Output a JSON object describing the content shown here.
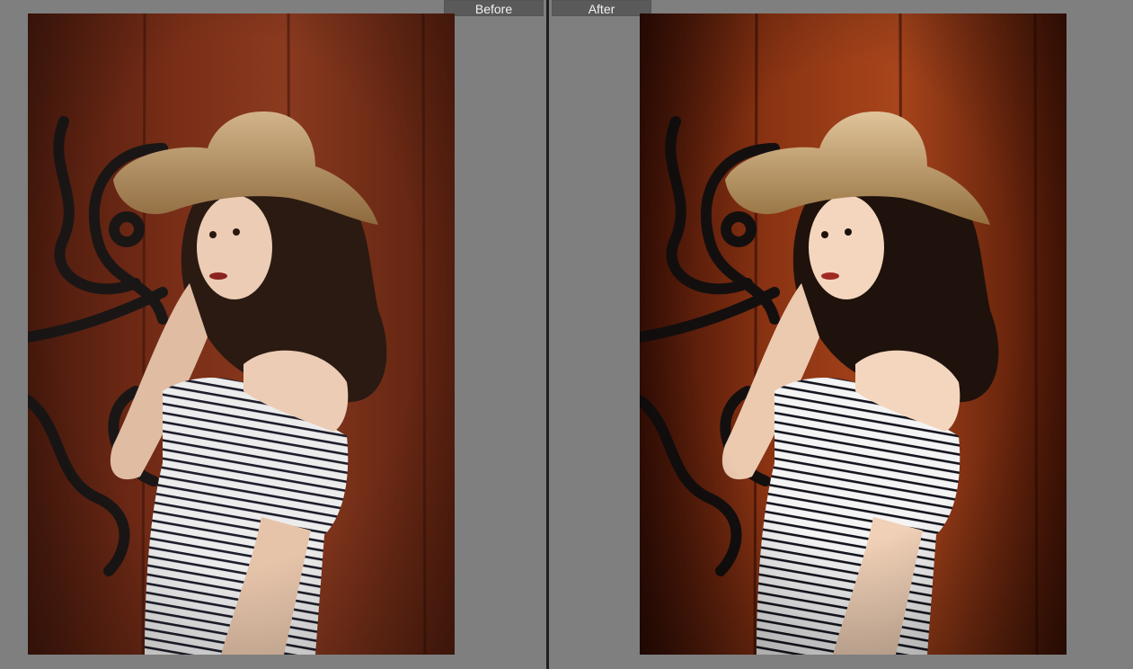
{
  "compare": {
    "before_label": "Before",
    "after_label": "After"
  },
  "photo": {
    "subject": "portrait-woman-straw-hat-striped-top",
    "before_palette": {
      "wood_dark": "#4a1a0d",
      "wood_mid": "#7a2e17",
      "wood_light": "#9c4426",
      "hat": "#c4a478",
      "skin": "#e8c8b0",
      "hair": "#2a1a12"
    },
    "after_palette": {
      "wood_dark": "#3a0f05",
      "wood_mid": "#7d2a10",
      "wood_light": "#b2481c",
      "hat": "#d4b488",
      "skin": "#f2d4bc",
      "hair": "#1f120c"
    }
  },
  "colors": {
    "background": "#7f7f7f",
    "label_bg": "#5a5a5a",
    "divider": "#1e1e1e"
  }
}
